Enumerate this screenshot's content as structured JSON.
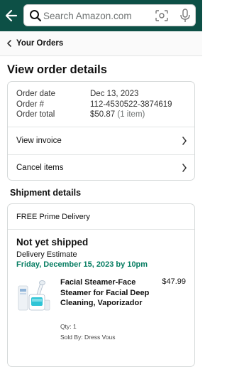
{
  "search": {
    "placeholder": "Search Amazon.com"
  },
  "breadcrumb": {
    "label": "Your Orders"
  },
  "page": {
    "title": "View order details"
  },
  "order_summary": {
    "rows": [
      {
        "label": "Order date",
        "value": "Dec 13, 2023",
        "note": ""
      },
      {
        "label": "Order #",
        "value": "112-4530522-3874619",
        "note": ""
      },
      {
        "label": "Order total",
        "value": "$50.87",
        "note": "(1 item)"
      }
    ],
    "view_invoice_label": "View invoice",
    "cancel_items_label": "Cancel items"
  },
  "shipment": {
    "section_title": "Shipment details",
    "delivery_type": "FREE Prime Delivery",
    "status": "Not yet shipped",
    "estimate_label": "Delivery Estimate",
    "estimate_date": "Friday, December 15, 2023 by 10pm",
    "item": {
      "title": "Facial Steamer-Face Steamer for Facial Deep Cleaning, Vaporizador",
      "price": "$47.99",
      "qty": "Qty: 1",
      "seller": "Sold By: Dress Vous"
    }
  },
  "colors": {
    "header": "#0d5046",
    "estimate_green": "#067d62"
  },
  "icons": [
    "back-arrow-icon",
    "search-icon",
    "camera-icon",
    "microphone-icon",
    "chevron-left-icon",
    "chevron-right-icon",
    "facial-steamer-product-image"
  ]
}
